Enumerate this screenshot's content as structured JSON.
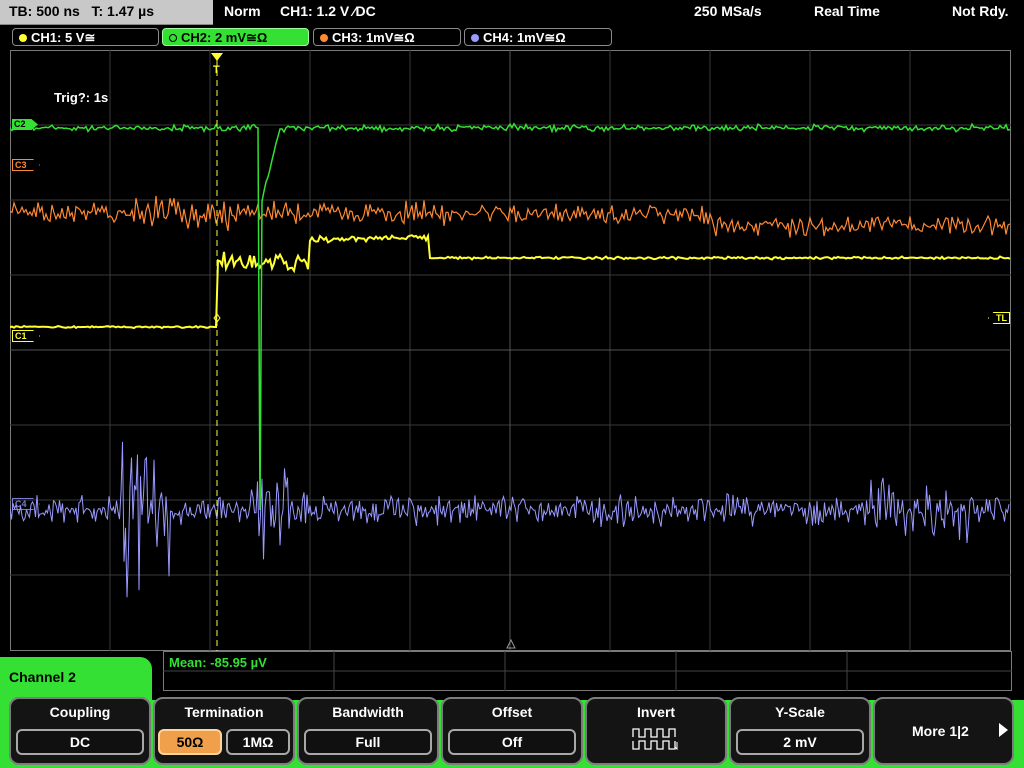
{
  "status_bar": {
    "timebase": "TB: 500 ns",
    "trigger_time": "T: 1.47 µs",
    "mode": "Norm",
    "trigger": "CH1: 1.2 V ⁄DC",
    "sample_rate": "250 MSa/s",
    "acq_mode": "Real Time",
    "state": "Not Rdy."
  },
  "channel_tabs": [
    {
      "label": "CH1: 5 V≅",
      "color": "#ffff33",
      "active": false
    },
    {
      "label": "CH2: 2 mV≅Ω",
      "color": "#33e033",
      "active": true
    },
    {
      "label": "CH3: 1mV≅Ω",
      "color": "#ff8833",
      "active": false
    },
    {
      "label": "CH4: 1mV≅Ω",
      "color": "#9999ff",
      "active": false
    }
  ],
  "display": {
    "trig_status": "Trig?: 1s",
    "markers": {
      "c1": "C1",
      "c2": "C2",
      "c3": "C3",
      "c4": "C4",
      "tl": "TL",
      "trigger_pos": "T"
    }
  },
  "measurement": {
    "text": "Mean: -85.95 µV"
  },
  "menu": {
    "title": "Channel 2",
    "coupling": {
      "label": "Coupling",
      "value": "DC"
    },
    "termination": {
      "label": "Termination",
      "options": [
        "50Ω",
        "1MΩ"
      ],
      "selected": "50Ω"
    },
    "bandwidth": {
      "label": "Bandwidth",
      "value": "Full"
    },
    "offset": {
      "label": "Offset",
      "value": "Off"
    },
    "invert": {
      "label": "Invert",
      "icon": "invert-square-wave-icon"
    },
    "yscale": {
      "label": "Y-Scale",
      "value": "2 mV"
    },
    "more": {
      "label": "More 1|2",
      "icon": "arrow-right-icon"
    }
  },
  "colors": {
    "ch1": "#ffff33",
    "ch2": "#33e033",
    "ch3": "#ff8833",
    "ch4": "#9999ff",
    "menu_accent": "#33e033",
    "selected_option": "#f0a04b"
  }
}
